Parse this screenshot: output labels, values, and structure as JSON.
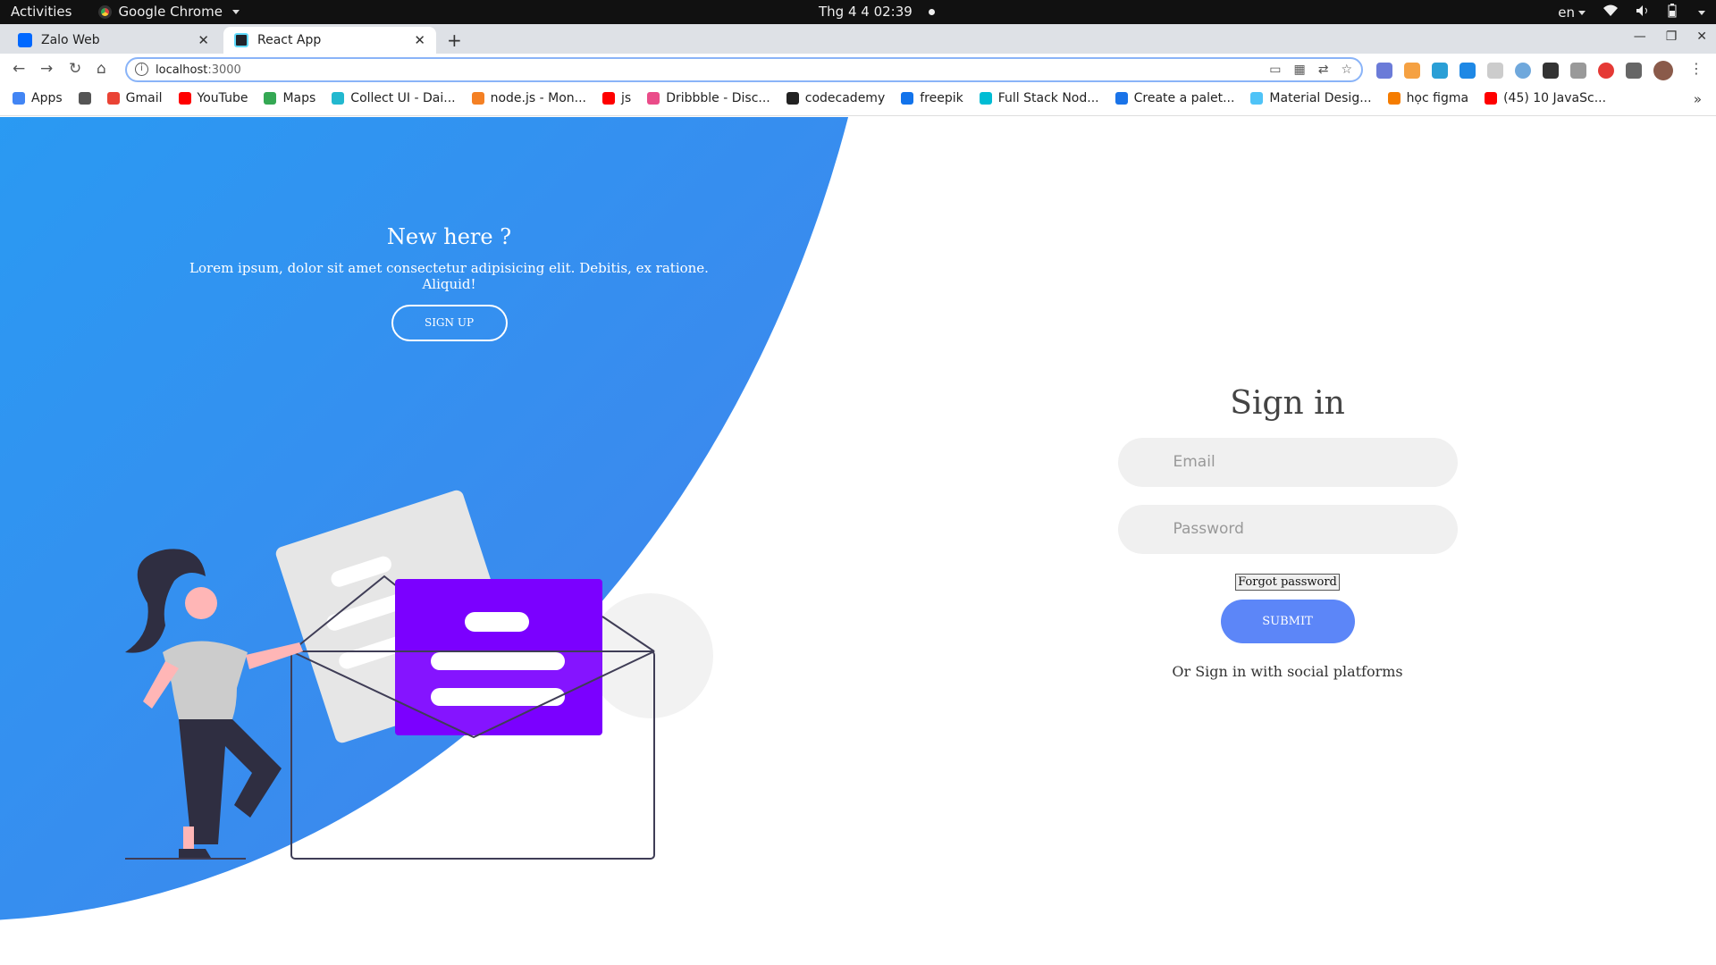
{
  "system_bar": {
    "activities": "Activities",
    "app_name": "Google Chrome",
    "datetime": "Thg 4 4  02:39",
    "language": "en"
  },
  "tabs": [
    {
      "title": "Zalo Web",
      "active": false
    },
    {
      "title": "React App",
      "active": true
    }
  ],
  "toolbar": {
    "url_host": "localhost",
    "url_port": ":3000"
  },
  "bookmarks": [
    {
      "label": "Apps",
      "color": "#4285f4"
    },
    {
      "label": "",
      "color": "#555555"
    },
    {
      "label": "Gmail",
      "color": "#ea4335"
    },
    {
      "label": "YouTube",
      "color": "#ff0000"
    },
    {
      "label": "Maps",
      "color": "#34a853"
    },
    {
      "label": "Collect UI - Dai...",
      "color": "#22b8cf"
    },
    {
      "label": "node.js - Mon...",
      "color": "#f48024"
    },
    {
      "label": "js",
      "color": "#ff0000"
    },
    {
      "label": "Dribbble - Disc...",
      "color": "#ea4c89"
    },
    {
      "label": "codecademy",
      "color": "#222222"
    },
    {
      "label": "freepik",
      "color": "#1273eb"
    },
    {
      "label": "Full Stack Nod...",
      "color": "#00bcd4"
    },
    {
      "label": "Create a palet...",
      "color": "#1a73e8"
    },
    {
      "label": "Material Desig...",
      "color": "#4fc3f7"
    },
    {
      "label": "học figma",
      "color": "#f57c00"
    },
    {
      "label": "(45) 10 JavaSc...",
      "color": "#ff0000"
    }
  ],
  "left_panel": {
    "heading": "New here ?",
    "text": "Lorem ipsum, dolor sit amet consectetur adipisicing elit. Debitis, ex ratione. Aliquid!",
    "signup_label": "SIGN UP"
  },
  "signin": {
    "title": "Sign in",
    "email_placeholder": "Email",
    "password_placeholder": "Password",
    "forgot_label": "Forgot password",
    "submit_label": "SUBMIT",
    "social_text": "Or Sign in with social platforms"
  },
  "colors": {
    "gradient_start": "#04befe",
    "gradient_end": "#4481eb",
    "submit_bg": "#5c86f8",
    "illustration_purple": "#7b00ff"
  }
}
